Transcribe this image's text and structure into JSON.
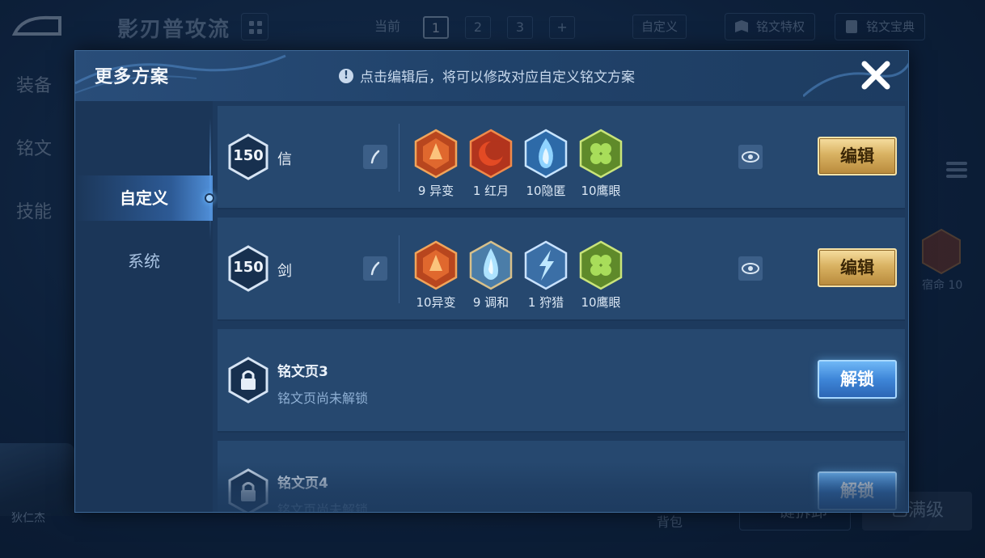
{
  "background": {
    "top_title": "影刃普攻流",
    "page_tabs": [
      "当前",
      "1",
      "2",
      "3",
      "+"
    ],
    "custom_label": "自定义",
    "rune_privilege_label": "铭文特权",
    "rune_guide_label": "铭文宝典",
    "left_tabs": [
      "装备",
      "铭文",
      "技能"
    ],
    "right_rune_label": "宿命 10",
    "hero_name": "狄仁杰",
    "bag_label": "背包",
    "bottom_btn1_label": "一键拆卸",
    "bottom_btn2_label": "已满级"
  },
  "modal": {
    "title": "更多方案",
    "notice": "点击编辑后，将可以修改对应自定义铭文方案",
    "side_nav": [
      "自定义",
      "系统"
    ],
    "plans": [
      {
        "level": "150",
        "name": "信",
        "runes": [
          {
            "label": "9 异变",
            "icon": "red-gem-rune"
          },
          {
            "label": "1 红月",
            "icon": "crescent-moon-rune"
          },
          {
            "label": "10隐匿",
            "icon": "blue-flame-rune"
          },
          {
            "label": "10鹰眼",
            "icon": "green-clover-rune"
          }
        ],
        "edit_label": "编辑"
      },
      {
        "level": "150",
        "name": "剑",
        "runes": [
          {
            "label": "10异变",
            "icon": "red-gem-rune"
          },
          {
            "label": "9 调和",
            "icon": "blue-drop-rune"
          },
          {
            "label": "1 狩猎",
            "icon": "lightning-rune"
          },
          {
            "label": "10鹰眼",
            "icon": "green-clover-rune"
          }
        ],
        "edit_label": "编辑"
      }
    ],
    "locked_pages": [
      {
        "title": "铭文页3",
        "subtitle": "铭文页尚未解锁",
        "unlock_label": "解锁"
      },
      {
        "title": "铭文页4",
        "subtitle": "铭文页尚未解锁",
        "unlock_label": "解锁"
      }
    ]
  }
}
